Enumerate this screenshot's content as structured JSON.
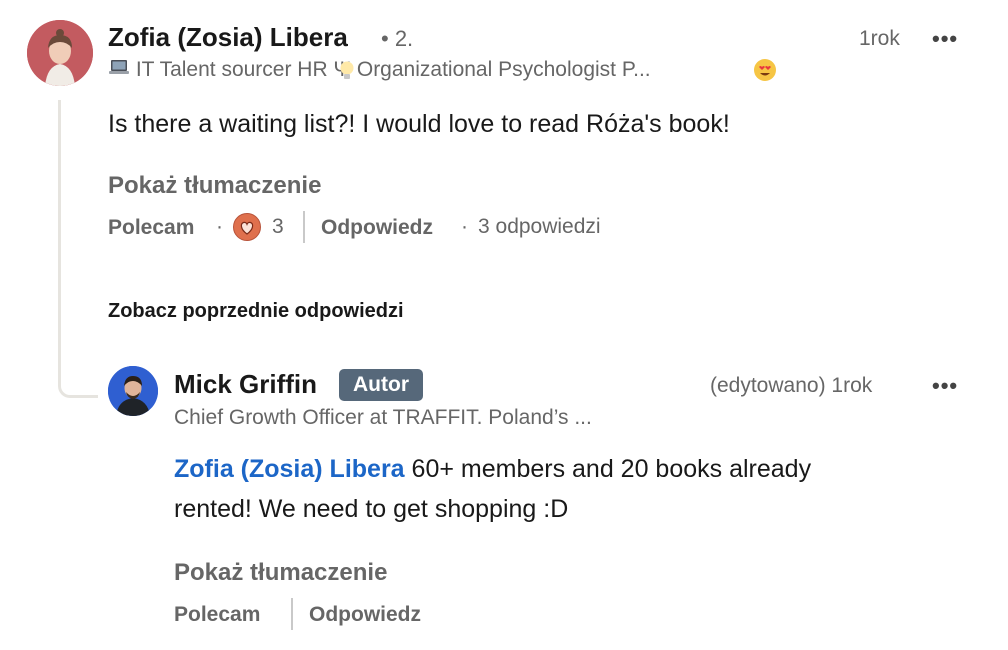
{
  "comment": {
    "author_name": "Zofia (Zosia) Libera",
    "degree": "• 2.",
    "headline": "IT Talent sourcer   HR Ψ Organizational Psychologist   P...",
    "timestamp": "1rok",
    "more_menu": "•••",
    "text": "Is there a waiting list?! I would love to read Róża's book!",
    "show_translation": "Pokaż tłumaczenie",
    "like_label": "Polecam",
    "dot": "·",
    "reaction_count": "3",
    "reply_label": "Odpowiedz",
    "replies_count": "3 odpowiedzi"
  },
  "see_previous_replies": "Zobacz poprzednie odpowiedzi",
  "reply": {
    "author_name": "Mick Griffin",
    "author_badge": "Autor",
    "headline": "Chief Growth Officer at TRAFFIT. Poland’s ...",
    "timestamp": "(edytowano) 1rok",
    "more_menu": "•••",
    "mention": "Zofia (Zosia) Libera",
    "text_line1": " 60+ members and 20 books already",
    "text_line2": "rented! We need to get shopping :D",
    "show_translation": "Pokaż tłumaczenie",
    "like_label": "Polecam",
    "reply_label": "Odpowiedz"
  },
  "icons": {
    "laptop": "laptop-icon",
    "bulb": "lightbulb-icon",
    "heart_eyes": "heart-eyes-emoji-icon",
    "love_reaction": "love-reaction-icon"
  },
  "colors": {
    "mention": "#1c66c7",
    "author_badge_bg": "#56687a",
    "love_reaction": "#df704d",
    "secondary_text": "#666666"
  }
}
